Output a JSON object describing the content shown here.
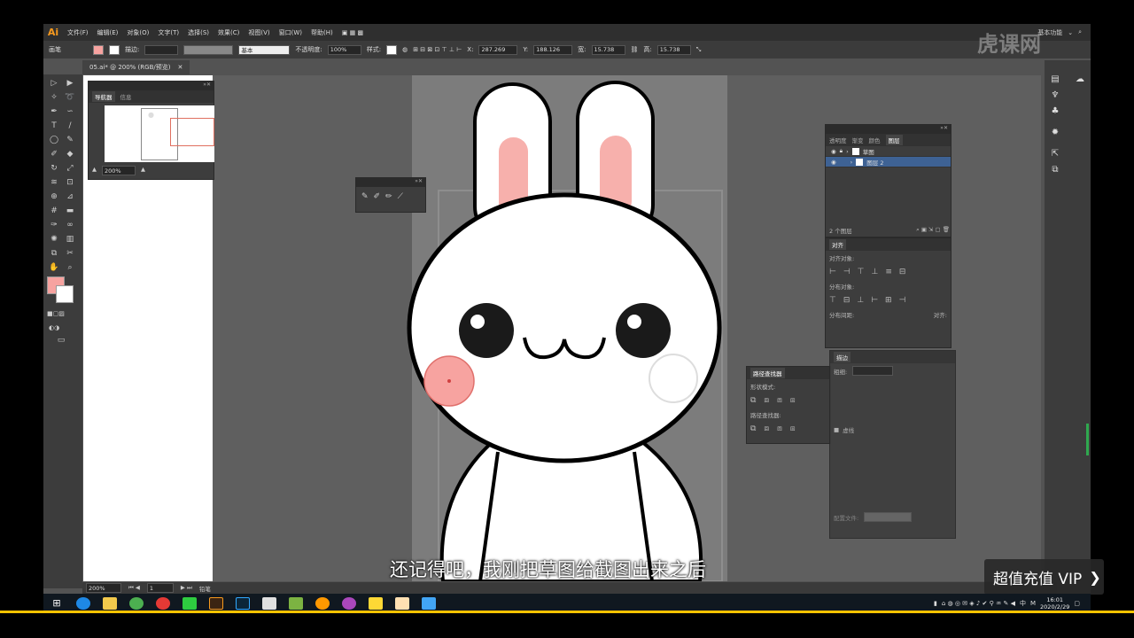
{
  "app": {
    "logo": "Ai",
    "menu": [
      "文件(F)",
      "编辑(E)",
      "对象(O)",
      "文字(T)",
      "选择(S)",
      "效果(C)",
      "视图(V)",
      "窗口(W)",
      "帮助(H)"
    ],
    "workspace": "基本功能",
    "document_tab": "05.ai* @ 200% (RGB/预览)"
  },
  "control_bar": {
    "selection_label": "画笔",
    "stroke_label": "描边:",
    "brush_label": "基本",
    "opacity_label": "不透明度:",
    "opacity_value": "100%",
    "style_label": "样式:",
    "x_label": "X:",
    "x_value": "287.269",
    "y_label": "Y:",
    "y_value": "188.126",
    "w_label": "宽:",
    "w_value": "15.738",
    "h_label": "高:",
    "h_value": "15.738"
  },
  "navigator": {
    "tabs": [
      "导航器",
      "信息"
    ],
    "zoom": "200%"
  },
  "layers_panel": {
    "tabs": [
      "透明度",
      "渐变",
      "颜色",
      "图层"
    ],
    "active_tab": "图层",
    "layers": [
      {
        "name": "草图",
        "selected": false
      },
      {
        "name": "图层 2",
        "selected": true
      }
    ],
    "count": "2 个图层"
  },
  "align_panel": {
    "title": "对齐",
    "align_objects": "对齐对象:",
    "distribute_objects": "分布对象:",
    "distribute_spacing": "分布间距:",
    "align_to": "对齐:"
  },
  "pathfinder_panel": {
    "title": "路径查找器",
    "shape_modes": "形状模式:",
    "pathfinders": "路径查找器:"
  },
  "stroke_panel": {
    "title": "描边",
    "weight_label": "粗细:",
    "dashed_label": "虚线",
    "profile_label": "配置文件:"
  },
  "statusbar": {
    "zoom": "200%",
    "page": "1",
    "tool": "铅笔"
  },
  "overlay": {
    "watermark": "虎课网",
    "subtitle": "还记得吧，我刚把草图给截图出来之后",
    "vip_button": "超值充值 VIP"
  },
  "taskbar": {
    "time": "16:01",
    "date": "2020/2/29",
    "ime": "中",
    "ime2": "M"
  },
  "colors": {
    "fill": "#f7a3a0",
    "canvas": "#5f5f5f",
    "highlight": "#3e6294"
  }
}
